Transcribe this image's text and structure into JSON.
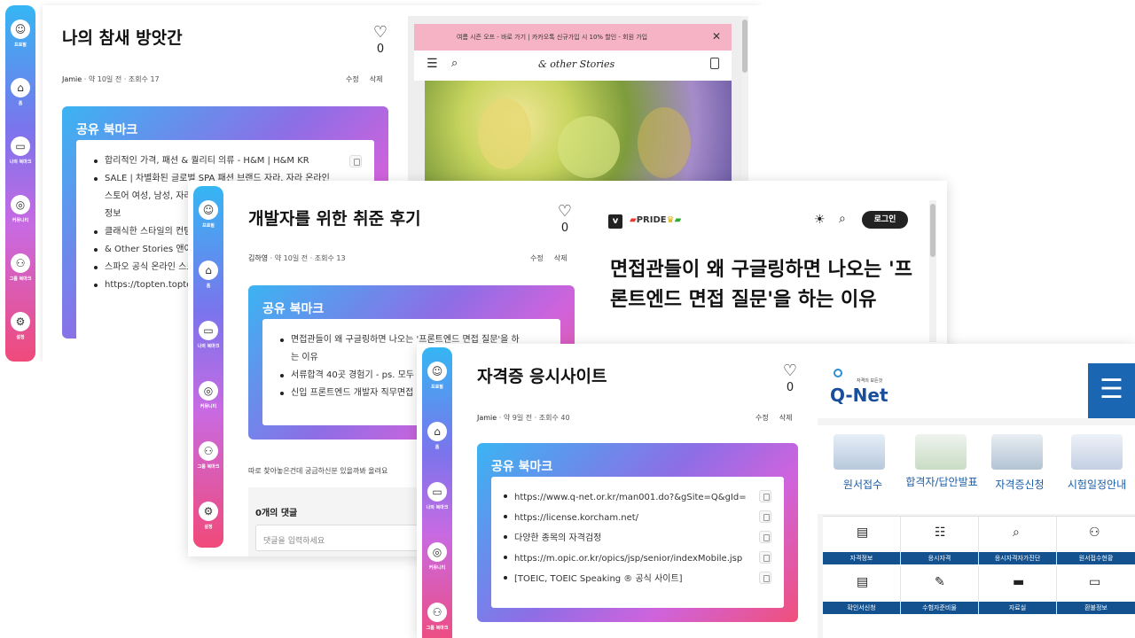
{
  "sidebar": {
    "items": [
      {
        "icon": "profile-icon",
        "label": "프로필",
        "glyph": "☺"
      },
      {
        "icon": "home-icon",
        "label": "홈",
        "glyph": "⌂"
      },
      {
        "icon": "folder-icon",
        "label": "나의 북마크",
        "glyph": "▭"
      },
      {
        "icon": "globe-icon",
        "label": "커뮤니티",
        "glyph": "◎"
      },
      {
        "icon": "group-icon",
        "label": "그룹 북마크",
        "glyph": "⚇"
      },
      {
        "icon": "settings-icon",
        "label": "설정",
        "glyph": "⚙"
      }
    ]
  },
  "cards": [
    {
      "title": "나의 참새 방앗간",
      "likes": "0",
      "author": "Jamie",
      "time": "약 10일 전",
      "views": "조회수 17",
      "edit": "수정",
      "delete": "삭제",
      "bookmark_title": "공유 북마크",
      "items": [
        "합리적인 가격, 패션 & 퀄리티 의류 - H&M | H&M KR",
        "SALE | 차별화된 글로벌 SPA 패션 브랜드 자라. 자라 온라인 스토어 여성, 남성, 자라 키즈, 재킷, 악세서리 등 제품 및 매장 정보",
        "클래식한 스타일의 컨템포러리",
        "& Other Stories 앤아더스토리즈",
        "스파오 공식 온라인 스토어",
        "https://topten.topten10mall.com"
      ],
      "preview": {
        "promo_text": "여름 시즌 오프 - 바로 가기 | 카카오톡 신규가입 시 10% 할인 - 회원 가입",
        "brand": "& other Stories"
      }
    },
    {
      "title": "개발자를 위한 취준 후기",
      "likes": "0",
      "author": "김하영",
      "time": "약 10일 전",
      "views": "조회수 13",
      "edit": "수정",
      "delete": "삭제",
      "bookmark_title": "공유 북마크",
      "items": [
        "면접관들이 왜 구글링하면 나오는 '프론트엔드 면접 질문'을 하는 이유",
        "서류합격 40곳 경험기 - ps. 모두 떨어짐",
        "신입 프론트엔드 개발자 직무면접 후기"
      ],
      "description": "따로 찾아놓은건데 궁금하신분 있을까봐 올려요",
      "comments_count": "0개의 댓글",
      "comment_placeholder": "댓글을 입력하세요",
      "preview": {
        "pride": "PRIDE",
        "login": "로그인",
        "headline": "면접관들이 왜 구글링하면 나오는 '프론트엔드 면접 질문'을 하는 이유"
      }
    },
    {
      "title": "자격증 응시사이트",
      "likes": "0",
      "author": "Jamie",
      "time": "약 9일 전",
      "views": "조회수 40",
      "edit": "수정",
      "delete": "삭제",
      "bookmark_title": "공유 북마크",
      "items": [
        "https://www.q-net.or.kr/man001.do?&gSite=Q&gId=",
        "https://license.korcham.net/",
        "다양한 종목의 자격검정",
        "https://m.opic.or.kr/opics/jsp/senior/indexMobile.jsp",
        "[TOEIC, TOEIC Speaking ® 공식 사이트]"
      ],
      "preview": {
        "logo_small": "자격의 모든것",
        "logo": "Q-Net",
        "tiles": [
          "원서접수",
          "합격자/답안발표",
          "자격증신청",
          "시험일정안내"
        ],
        "menu": [
          "자격정보",
          "응시자격",
          "응시자격자가진단",
          "원서접수현황",
          "확인서신청",
          "수험자준비물",
          "자료실",
          "환불정보"
        ]
      }
    }
  ]
}
